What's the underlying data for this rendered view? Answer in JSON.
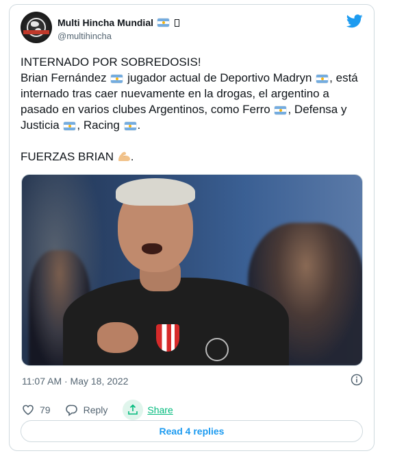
{
  "author": {
    "display_name": "Multi Hincha Mundial",
    "handle": "@multihincha",
    "avatar_icon": "multi-hincha-logo"
  },
  "tweet": {
    "line1": "INTERNADO POR SOBREDOSIS!",
    "p2_a": "Brian Fernández ",
    "p2_b": " jugador actual de Deportivo Madryn ",
    "p2_c": ", está internado tras caer nuevamente en la drogas, el argentino a pasado en varios clubes Argentinos, como Ferro ",
    "p2_d": ", Defensa y Justicia ",
    "p2_e": ", Racing ",
    "p2_f": ".",
    "p3_a": "FUERZAS BRIAN ",
    "p3_b": "."
  },
  "timestamp": "11:07 AM · May 18, 2022",
  "actions": {
    "likes": "79",
    "reply_label": "Reply",
    "share_label": "Share"
  },
  "replies_button": "Read 4 replies",
  "colors": {
    "accent": "#1d9bf0",
    "share": "#00ba7c",
    "muted": "#536471"
  }
}
